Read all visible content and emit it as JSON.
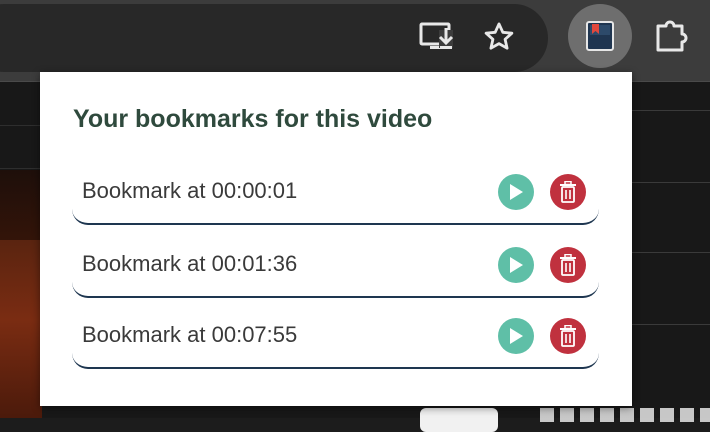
{
  "browser": {
    "toolbar_icons": [
      "install-icon",
      "star-icon",
      "bookmark-extension-icon",
      "puzzle-icon"
    ]
  },
  "popup": {
    "title": "Your bookmarks for this video",
    "bookmarks": [
      {
        "label": "Bookmark at 00:00:01"
      },
      {
        "label": "Bookmark at 00:01:36"
      },
      {
        "label": "Bookmark at 00:07:55"
      }
    ]
  },
  "colors": {
    "title": "#2f4a3d",
    "play": "#5fbfa7",
    "delete": "#c0313e",
    "row_border": "#1e3650"
  }
}
